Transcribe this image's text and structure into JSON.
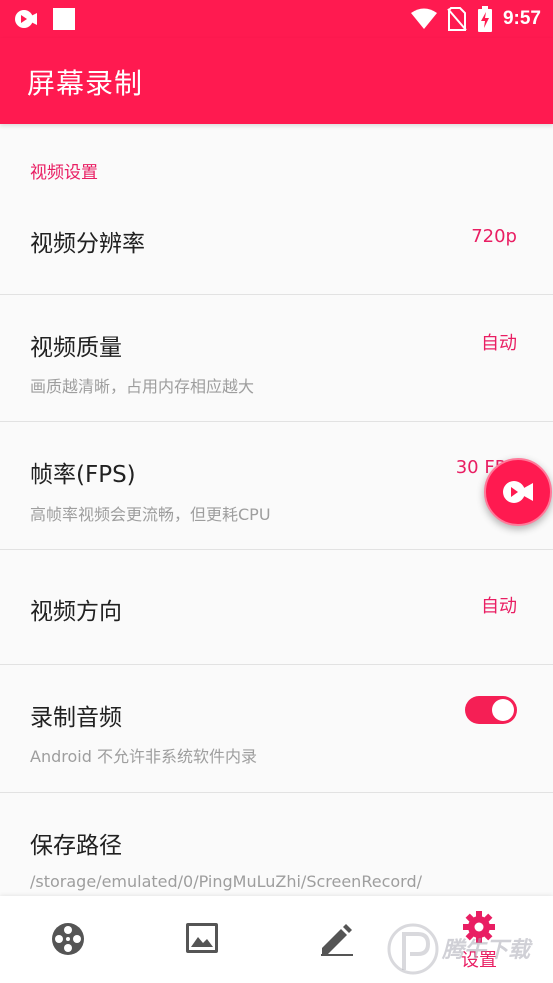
{
  "status_bar": {
    "time": "9:57",
    "icons": [
      "video-record-icon",
      "square-icon",
      "wifi-icon",
      "no-sim-icon",
      "battery-charging-icon"
    ]
  },
  "app_bar": {
    "title": "屏幕录制"
  },
  "settings": {
    "section_header": "视频设置",
    "items": [
      {
        "title": "视频分辨率",
        "value": "720p"
      },
      {
        "title": "视频质量",
        "summary": "画质越清晰，占用内存相应越大",
        "value": "自动"
      },
      {
        "title": "帧率(FPS)",
        "summary": "高帧率视频会更流畅，但更耗CPU",
        "value": "30 FPS"
      },
      {
        "title": "视频方向",
        "value": "自动"
      },
      {
        "title": "录制音频",
        "summary": "Android 不允许非系统软件内录",
        "toggle_on": true
      },
      {
        "title": "保存路径",
        "summary": "/storage/emulated/0/PingMuLuZhi/ScreenRecord/"
      }
    ]
  },
  "fab": {
    "icon": "video-record-icon"
  },
  "bottom_nav": {
    "items": [
      {
        "icon": "film-reel-icon",
        "label": ""
      },
      {
        "icon": "image-icon",
        "label": ""
      },
      {
        "icon": "edit-pencil-icon",
        "label": ""
      },
      {
        "icon": "gear-icon",
        "label": "设置",
        "active": true
      }
    ]
  },
  "watermark": {
    "text": "腾牛下载"
  },
  "colors": {
    "primary": "#ff1a50",
    "accent": "#e91e63",
    "divider": "#e2e2e2",
    "secondary_text": "#9e9e9e"
  }
}
